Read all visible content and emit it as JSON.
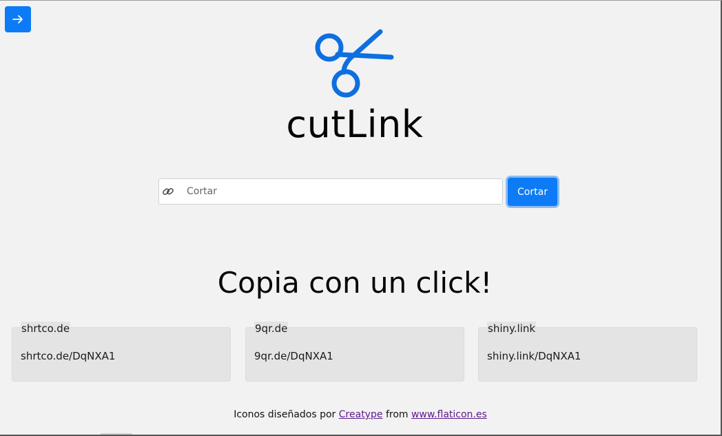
{
  "menu": {
    "icon": "arrow-right-icon"
  },
  "logo": {
    "icon": "scissors-icon",
    "color": "#0d6fe0"
  },
  "app": {
    "title": "cutLink"
  },
  "search": {
    "placeholder": "Cortar",
    "value": "",
    "icon": "link-icon"
  },
  "actions": {
    "cut_label": "Cortar"
  },
  "tagline": "Copia con un click!",
  "results": [
    {
      "service": "shrtco.de",
      "link": "shrtco.de/DqNXA1"
    },
    {
      "service": "9qr.de",
      "link": "9qr.de/DqNXA1"
    },
    {
      "service": "shiny.link",
      "link": "shiny.link/DqNXA1"
    }
  ],
  "footer": {
    "prefix": "Iconos diseñados por",
    "author": "Creatype",
    "middle": "from",
    "site": "www.flaticon.es"
  },
  "colors": {
    "accent": "#0d7bf5",
    "background": "#f2f2f2",
    "card": "#e4e4e4",
    "link": "#5b1a8c"
  }
}
